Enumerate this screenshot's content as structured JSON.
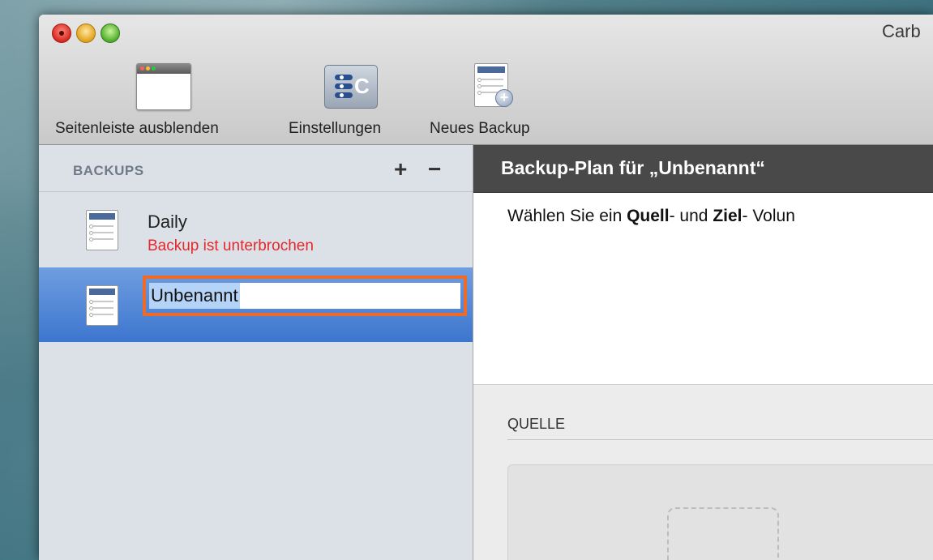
{
  "window": {
    "title": "Carb"
  },
  "toolbar": {
    "hide_sidebar_label": "Seitenleiste ausblenden",
    "settings_label": "Einstellungen",
    "new_backup_label": "Neues Backup",
    "settings_icon_glyph": "C"
  },
  "sidebar": {
    "header": "BACKUPS",
    "add_glyph": "+",
    "remove_glyph": "−",
    "items": [
      {
        "name": "Daily",
        "status": "Backup ist unterbrochen"
      },
      {
        "name": "Unbenannt",
        "editing": true
      }
    ]
  },
  "main": {
    "plan_title": "Backup-Plan für „Unbenannt“",
    "instruction": {
      "part1": "Wählen Sie ein ",
      "bold1": "Quell",
      "part2": "- und ",
      "bold2": "Ziel",
      "part3": "- Volun"
    },
    "source_label": "QUELLE"
  },
  "colors": {
    "status_error": "#e5272b",
    "selection_blue": "#3d76cf",
    "rename_highlight": "#ef6a26",
    "header_dark": "#494949"
  }
}
